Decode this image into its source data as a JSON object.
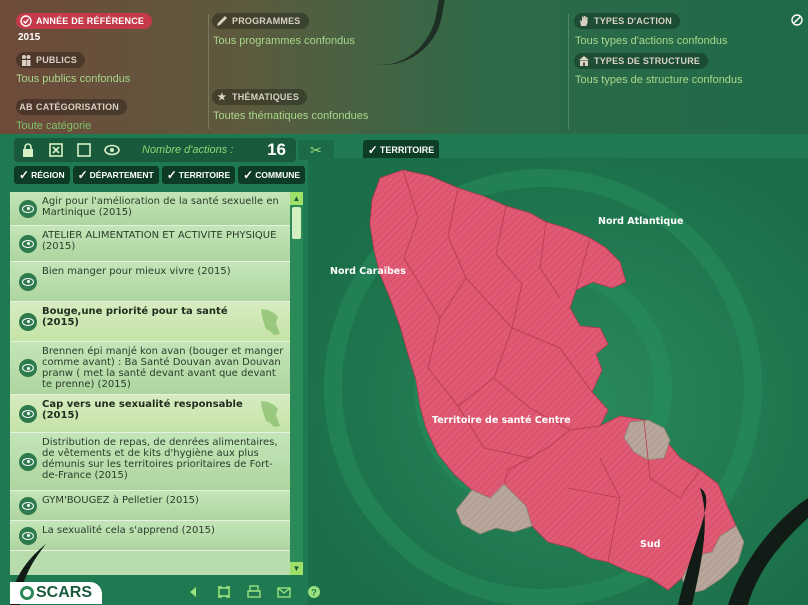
{
  "filters": {
    "annee": {
      "label": "Année de référence",
      "value": "2015"
    },
    "publics": {
      "label": "Publics",
      "value": "Tous publics confondus"
    },
    "categorisation": {
      "label": "Catégorisation",
      "value": "Toute catégorie"
    },
    "programmes": {
      "label": "Programmes",
      "value": "Tous programmes confondus"
    },
    "thematiques": {
      "label": "Thématiques",
      "value": "Toutes thématiques confondues"
    },
    "types_action": {
      "label": "Types d'action",
      "value": "Tous types d'actions confondus"
    },
    "types_structure": {
      "label": "Types de structure",
      "value": "Tous types de structure confondus"
    }
  },
  "toolbar": {
    "count_label": "Nombre d'actions :",
    "count_value": "16",
    "territory_tab": "Territoire",
    "levels": [
      "Région",
      "Département",
      "Territoire",
      "Commune"
    ]
  },
  "actions": [
    {
      "title": "Agir pour l'amélioration de la santé sexuelle en Martinique (2015)",
      "bold": false,
      "map": false
    },
    {
      "title": "ATELIER ALIMENTATION ET ACTIVITE PHYSIQUE (2015)",
      "bold": false,
      "map": false
    },
    {
      "title": "Bien manger pour mieux vivre (2015)",
      "bold": false,
      "map": false
    },
    {
      "title": "Bouge,une priorité pour ta santé (2015)",
      "bold": true,
      "map": true
    },
    {
      "title": "Brennen épi manjé kon avan (bouger et manger comme avant) : Ba Santé Douvan avan Douvan pranw ( met la santé devant avant que devant te prenne) (2015)",
      "bold": false,
      "map": false
    },
    {
      "title": "Cap vers une sexualité responsable (2015)",
      "bold": true,
      "map": true
    },
    {
      "title": "Distribution de repas, de denrées alimentaires, de vêtements et de kits d'hygiène aux plus démunis sur les territoires prioritaires de Fort-de-France (2015)",
      "bold": false,
      "map": false
    },
    {
      "title": "GYM'BOUGEZ à Pelletier (2015)",
      "bold": false,
      "map": false
    },
    {
      "title": "La sexualité cela s'apprend (2015)",
      "bold": false,
      "map": false
    }
  ],
  "map": {
    "labels": {
      "nord_atlantique": "Nord Atlantique",
      "nord_caraibes": "Nord Caraïbes",
      "centre": "Territoire de santé Centre",
      "sud": "Sud"
    },
    "colors": {
      "active": "#e05a74",
      "inactive": "#b8a79a",
      "background": "#1f7a52"
    }
  },
  "footer": {
    "logo": "SCARS"
  }
}
